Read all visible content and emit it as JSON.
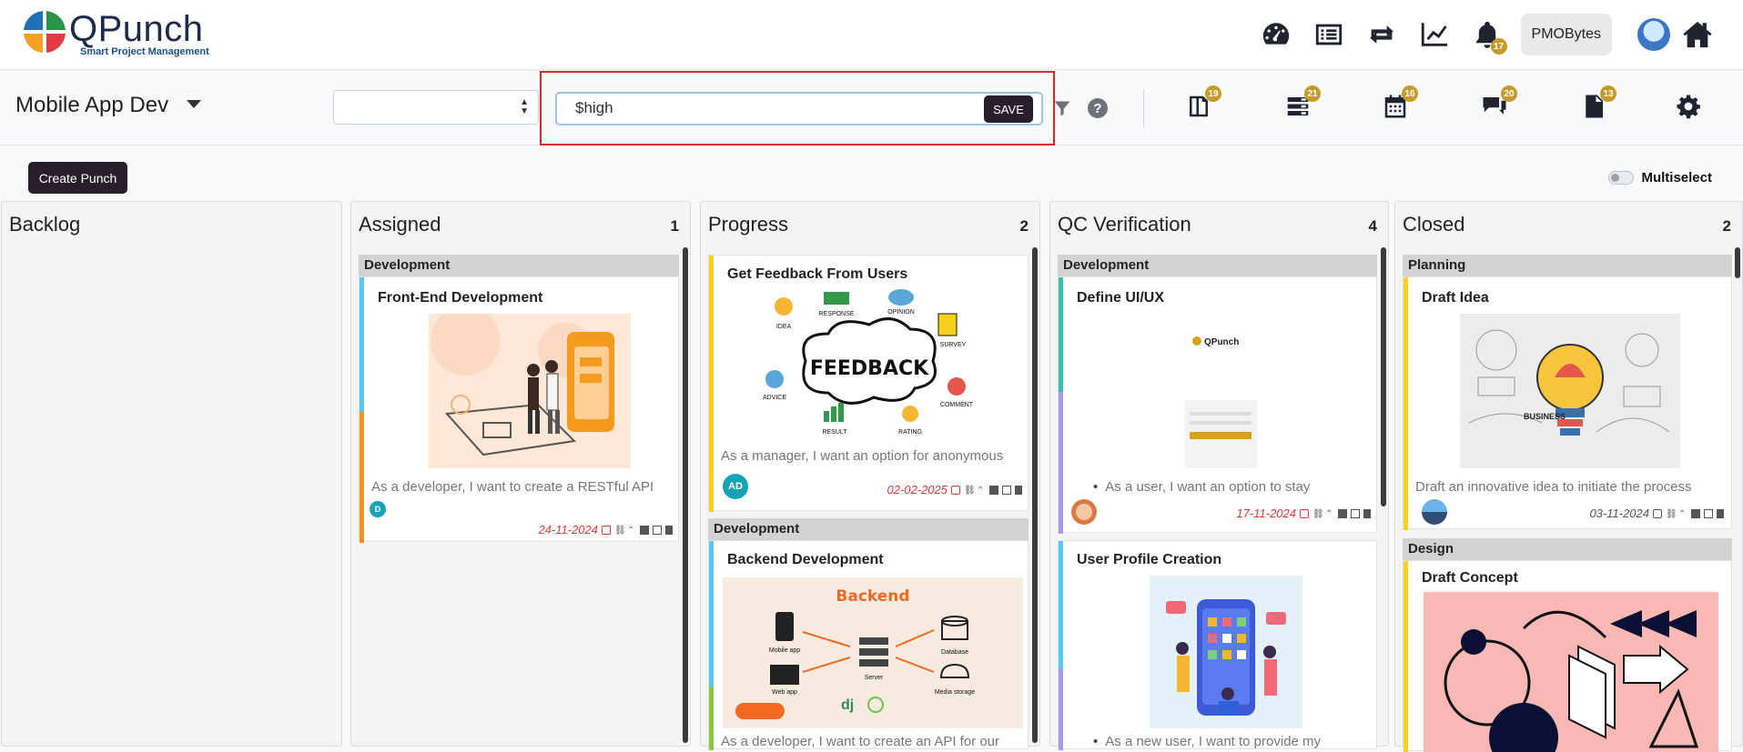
{
  "app": {
    "name": "QPunch",
    "tagline": "Smart Project Management"
  },
  "topbar": {
    "notifications_count": "17",
    "user_label": "PMOBytes",
    "icons": [
      "dashboard-icon",
      "list-icon",
      "sync-icon",
      "chart-icon",
      "bell-icon",
      "avatar",
      "home-icon"
    ]
  },
  "subbar": {
    "project_title": "Mobile App Dev",
    "search_value": "$high",
    "save_label": "SAVE",
    "badges": {
      "book": "19",
      "stack": "21",
      "calendar": "16",
      "chat": "20",
      "note": "13"
    }
  },
  "actions": {
    "create_label": "Create Punch",
    "multiselect_label": "Multiselect"
  },
  "columns": [
    {
      "name": "Backlog",
      "count": ""
    },
    {
      "name": "Assigned",
      "count": "1"
    },
    {
      "name": "Progress",
      "count": "2"
    },
    {
      "name": "QC Verification",
      "count": "4"
    },
    {
      "name": "Closed",
      "count": "2"
    }
  ],
  "cards": {
    "assigned_1": {
      "group": "Development",
      "title": "Front-End Development",
      "desc": "As a developer, I want to create a RESTful API",
      "assignee": "D",
      "date": "24-11-2024"
    },
    "progress_1": {
      "title": "Get Feedback From Users",
      "desc": "As a manager, I want an option for anonymous",
      "assignee": "AD",
      "date": "02-02-2025",
      "img_text": "FEEDBACK",
      "labels": [
        "IDEA",
        "RESPONSE",
        "OPINION",
        "SURVEY",
        "ADVICE",
        "COMMENT",
        "RESULT",
        "RATING"
      ]
    },
    "progress_2": {
      "group": "Development",
      "title": "Backend Development",
      "desc": "As a developer, I want to create an API for our",
      "img_title": "Backend",
      "labels": [
        "Mobile app",
        "Web app",
        "Server",
        "Database",
        "Media storage"
      ]
    },
    "qc_1": {
      "group": "Development",
      "title": "Define UI/UX",
      "desc": "As a user, I want an option to stay",
      "date": "17-11-2024",
      "img_text": "QPunch"
    },
    "qc_2": {
      "title": "User Profile Creation",
      "desc": "As a new user, I want to provide my"
    },
    "closed_1": {
      "group": "Planning",
      "title": "Draft Idea",
      "desc": "Draft an innovative idea to initiate the process",
      "date": "03-11-2024",
      "img_text": "BUSINESS"
    },
    "closed_2": {
      "group": "Design",
      "title": "Draft Concept"
    }
  },
  "colors": {
    "accent_dark": "#2a1e2d",
    "highlight_red": "#e0262a",
    "badge_gold": "#c59b2c",
    "date_red": "#e53935"
  }
}
